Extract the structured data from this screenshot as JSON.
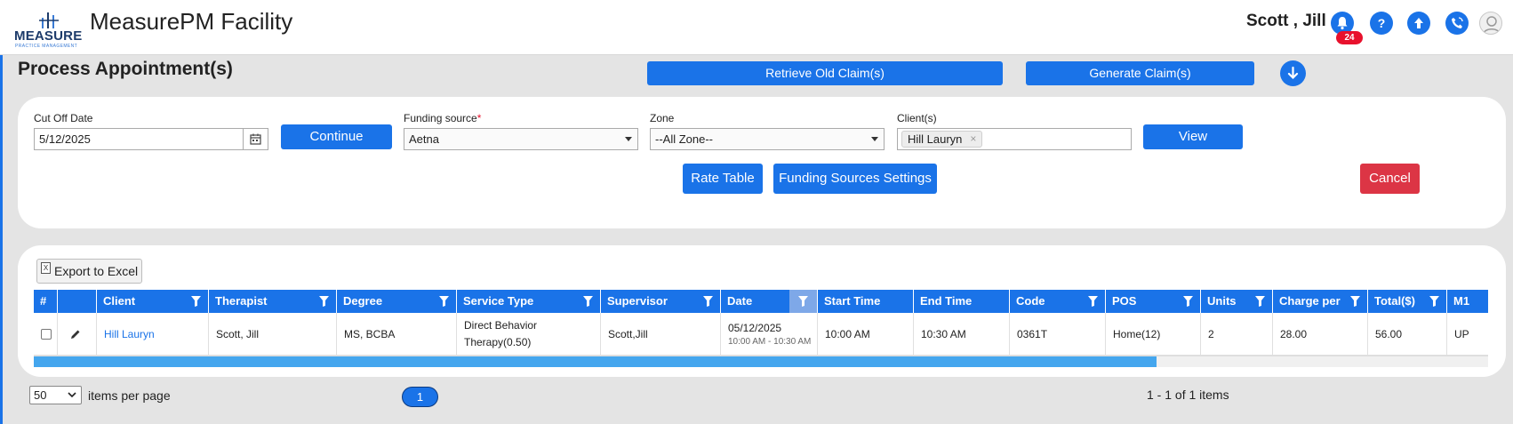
{
  "header": {
    "logo_text": "MEASURE",
    "logo_subtext": "PRACTICE MANAGEMENT",
    "app_title": "MeasurePM Facility",
    "user_name": "Scott , Jill",
    "notification_count": "24",
    "icons": [
      "bell-icon",
      "help-icon",
      "upload-icon",
      "phone-icon",
      "user-avatar-icon"
    ],
    "accent_color": "#1a73e8",
    "badge_color": "#e8112d"
  },
  "page": {
    "title": "Process Appointment(s)",
    "retrieve_label": "Retrieve Old Claim(s)",
    "generate_label": "Generate Claim(s)"
  },
  "filters": {
    "cutoff_label": "Cut Off Date",
    "cutoff_value": "5/12/2025",
    "continue_label": "Continue",
    "funding_label": "Funding source",
    "funding_required": "*",
    "funding_value": "Aetna",
    "zone_label": "Zone",
    "zone_value": "--All Zone--",
    "clients_label": "Client(s)",
    "client_chip": "Hill Lauryn",
    "chip_remove": "×",
    "view_label": "View",
    "rate_table_label": "Rate Table",
    "funding_settings_label": "Funding Sources Settings",
    "cancel_label": "Cancel",
    "cancel_color": "#dc3545"
  },
  "grid": {
    "export_label": "Export to Excel",
    "export_icon_text": "X",
    "columns": [
      "#",
      "",
      "Client",
      "Therapist",
      "Degree",
      "Service Type",
      "Supervisor",
      "Date",
      "Start Time",
      "End Time",
      "Code",
      "POS",
      "Units",
      "Charge per",
      "Total($)",
      "M1"
    ],
    "rows": [
      {
        "client": "Hill Lauryn",
        "therapist": "Scott, Jill",
        "degree": "MS, BCBA",
        "service_type": "Direct Behavior Therapy(0.50)",
        "supervisor": "Scott,Jill",
        "date": "05/12/2025",
        "date_range": "10:00 AM - 10:30 AM",
        "start_time": "10:00 AM",
        "end_time": "10:30 AM",
        "code": "0361T",
        "pos": "Home(12)",
        "units": "2",
        "charge_per": "28.00",
        "total": "56.00",
        "m1": "UP"
      }
    ]
  },
  "pager": {
    "page_size": "50",
    "items_per_page_label": "items per page",
    "current_page": "1",
    "info": "1 - 1 of 1 items"
  }
}
